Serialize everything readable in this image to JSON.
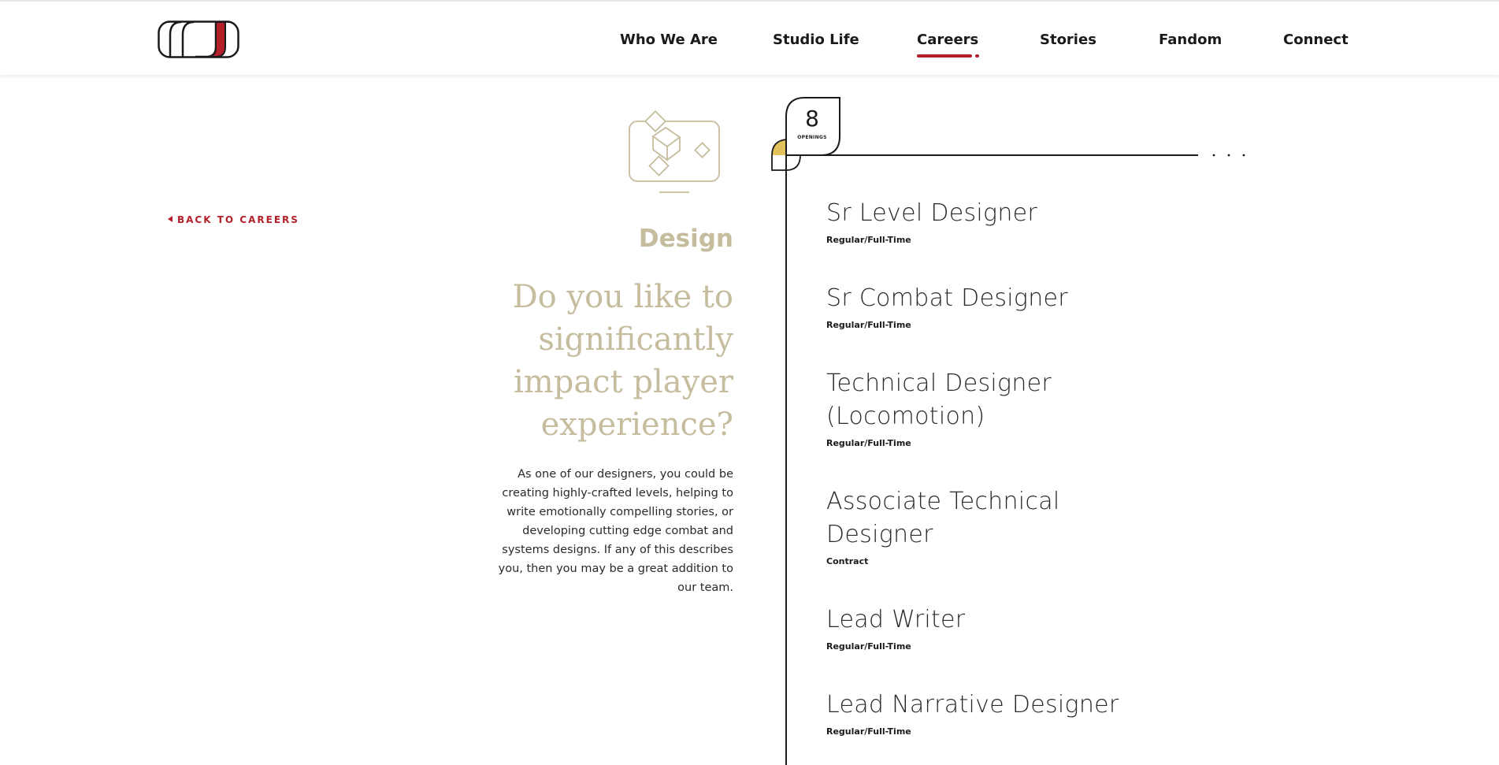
{
  "header": {
    "nav": [
      {
        "label": "Who We Are"
      },
      {
        "label": "Studio Life"
      },
      {
        "label": "Careers"
      },
      {
        "label": "Stories"
      },
      {
        "label": "Fandom"
      },
      {
        "label": "Connect"
      }
    ],
    "active_nav": "Careers"
  },
  "back_link": {
    "label": "BACK TO CAREERS"
  },
  "department": {
    "title": "Design",
    "heading": "Do you like to significantly impact player experience?",
    "body": "As one of our designers, you could be creating highly-crafted levels, helping to write emotionally compelling stories, or developing cutting edge combat and systems designs. If any of this describes you, then you may be a great addition to our team.",
    "icon": "design-monitor-icon"
  },
  "openings": {
    "count": "8",
    "label": "OPENINGS"
  },
  "jobs": [
    {
      "title": "Sr Level Designer",
      "type": "Regular/Full-Time"
    },
    {
      "title": "Sr Combat Designer",
      "type": "Regular/Full-Time"
    },
    {
      "title": "Technical Designer (Locomotion)",
      "type": "Regular/Full-Time"
    },
    {
      "title": "Associate Technical Designer",
      "type": "Contract"
    },
    {
      "title": "Lead Writer",
      "type": "Regular/Full-Time"
    },
    {
      "title": "Lead Narrative Designer",
      "type": "Regular/Full-Time"
    }
  ],
  "colors": {
    "accent": "#b3202a",
    "tan": "#c6bc9e",
    "gold": "#e2c25a",
    "text": "#1a1a1a"
  }
}
